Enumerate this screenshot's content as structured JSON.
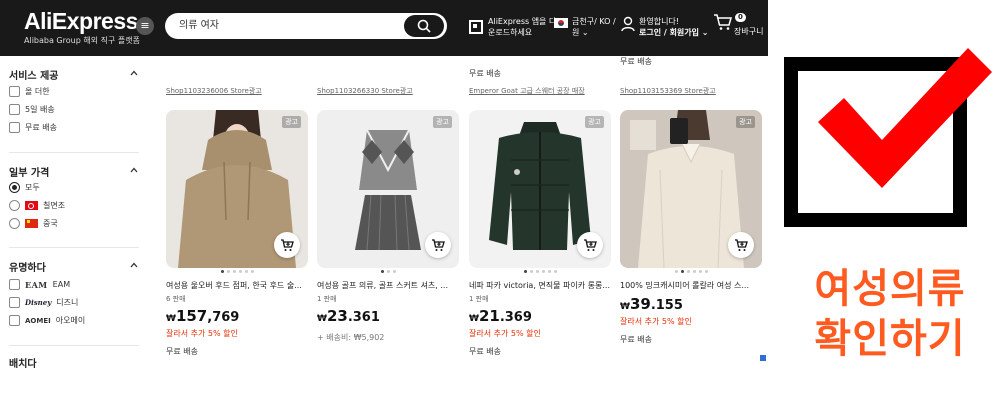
{
  "header": {
    "logo_main": "AliExpress",
    "logo_sub": "Alibaba Group 해외 직구 플랫폼",
    "search_value": "의류 여자",
    "app_line1": "AliExpress 앱을 다",
    "app_line2": "운로드하세요",
    "lang_line1": "금천구/ KO /",
    "lang_line2": "원 ⌄",
    "user_line1": "환영합니다!",
    "user_line2": "로그인 / 회원가입 ⌄",
    "cart_count": "0",
    "cart_label": "장바구니"
  },
  "sidebar": {
    "service_title": "서비스 제공",
    "service_options": [
      "올 더한",
      "5일 배송",
      "무료 배송"
    ],
    "price_title": "일부 가격",
    "price_options": [
      "모두",
      "칠면조",
      "중국"
    ],
    "brand_title": "유명하다",
    "brand_options": [
      {
        "logo": "EAM",
        "label": "EAM"
      },
      {
        "logo": "Disney",
        "label": "디즈니"
      },
      {
        "logo": "AOMEI",
        "label": "아오메이"
      }
    ],
    "next_title": "배치다"
  },
  "top_row": [
    "무료 배송",
    "무료 배송"
  ],
  "products": [
    {
      "shop": "Shop1103236006 Store광고",
      "ad": "광고",
      "title": "여성용 울오버 후드 점퍼, 한국 후드 술...",
      "sold": "6 판매",
      "price_cur": "₩",
      "price_main": "157",
      "price_rest": ",769",
      "promo": "잘라서 추가 5% 할인",
      "extra": "",
      "shipping": "무료 배송"
    },
    {
      "shop": "Shop1103266330 Store광고",
      "ad": "광고",
      "title": "여성용 골프 의류, 골프 스커트 셔츠, ...",
      "sold": "1 판매",
      "price_cur": "₩",
      "price_main": "23",
      "price_rest": ".361",
      "promo": "",
      "extra": "+ 배송비: ₩5,902",
      "shipping": ""
    },
    {
      "shop": "Emperor Goat 고급 스웨터 공장 매장",
      "ad": "광고",
      "title": "네파 파카 victoria, 면직물 파이카 롱롱...",
      "sold": "1 판매",
      "price_cur": "₩",
      "price_main": "21",
      "price_rest": ".369",
      "promo": "잘라서 추가 5% 할인",
      "extra": "",
      "shipping": "무료 배송"
    },
    {
      "shop": "Shop1103153369 Store광고",
      "ad": "광고",
      "title": "100% 밍크캐시미어 롤칼라 여성 스...",
      "sold": "",
      "price_cur": "₩",
      "price_main": "39",
      "price_rest": ".155",
      "promo": "잘라서 추가 5% 할인",
      "extra": "",
      "shipping": "무료 배송"
    }
  ],
  "overlay": {
    "line1": "여성의류",
    "line2": "확인하기",
    "text_color": "#ff5a1f",
    "check_color": "#ff0000"
  }
}
